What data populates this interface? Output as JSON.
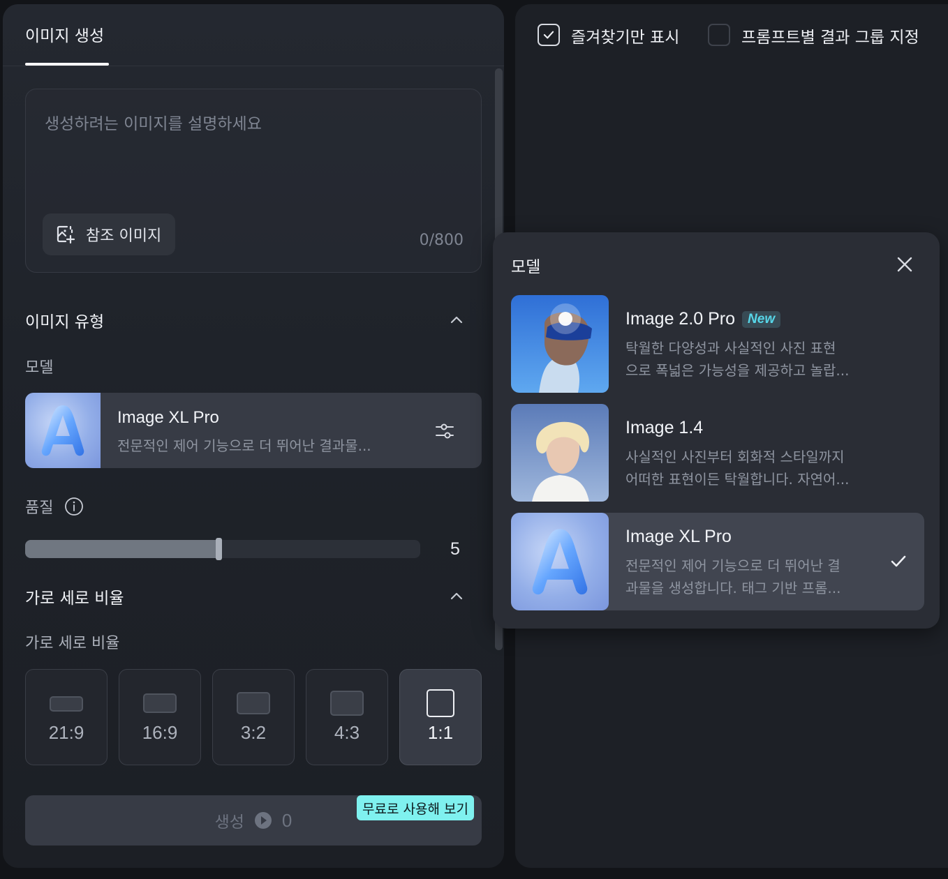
{
  "left_panel": {
    "tab_label": "이미지 생성",
    "prompt_placeholder": "생성하려는 이미지를 설명하세요",
    "reference_image_label": "참조 이미지",
    "char_count": "0/800",
    "image_type_title": "이미지 유형",
    "model_label": "모델",
    "selected_model": {
      "name": "Image XL Pro",
      "description": "전문적인 제어 기능으로 더 뛰어난 결과물..."
    },
    "quality_label": "품질",
    "quality_value": "5",
    "quality_fraction": 0.49,
    "aspect_title": "가로 세로 비율",
    "aspect_label": "가로 세로 비율",
    "aspect_ratios": [
      "21:9",
      "16:9",
      "3:2",
      "4:3",
      "1:1"
    ],
    "selected_ratio": "1:1",
    "generate_label": "생성",
    "generate_credit": "0",
    "free_badge": "무료로 사용해 보기"
  },
  "right_panel": {
    "favorites_only_label": "즐겨찾기만 표시",
    "favorites_only_checked": true,
    "group_by_prompt_label": "프롬프트별 결과 그룹 지정",
    "group_by_prompt_checked": false
  },
  "model_popup": {
    "title": "모델",
    "items": [
      {
        "name": "Image 2.0 Pro",
        "badge": "New",
        "line1": "탁월한 다양성과 사실적인 사진 표현",
        "line2": "으로 폭넓은 가능성을 제공하고 놀랍...",
        "selected": false
      },
      {
        "name": "Image 1.4",
        "badge": "",
        "line1": "사실적인 사진부터 회화적 스타일까지",
        "line2": "어떠한 표현이든 탁월합니다. 자연어...",
        "selected": false
      },
      {
        "name": "Image XL Pro",
        "badge": "",
        "line1": "전문적인 제어 기능으로 더 뛰어난 결",
        "line2": "과물을 생성합니다. 태그 기반 프롬...",
        "selected": true
      }
    ]
  },
  "colors": {
    "accent_badge": "#7ff1ef",
    "new_badge_text": "#57d6e8"
  }
}
